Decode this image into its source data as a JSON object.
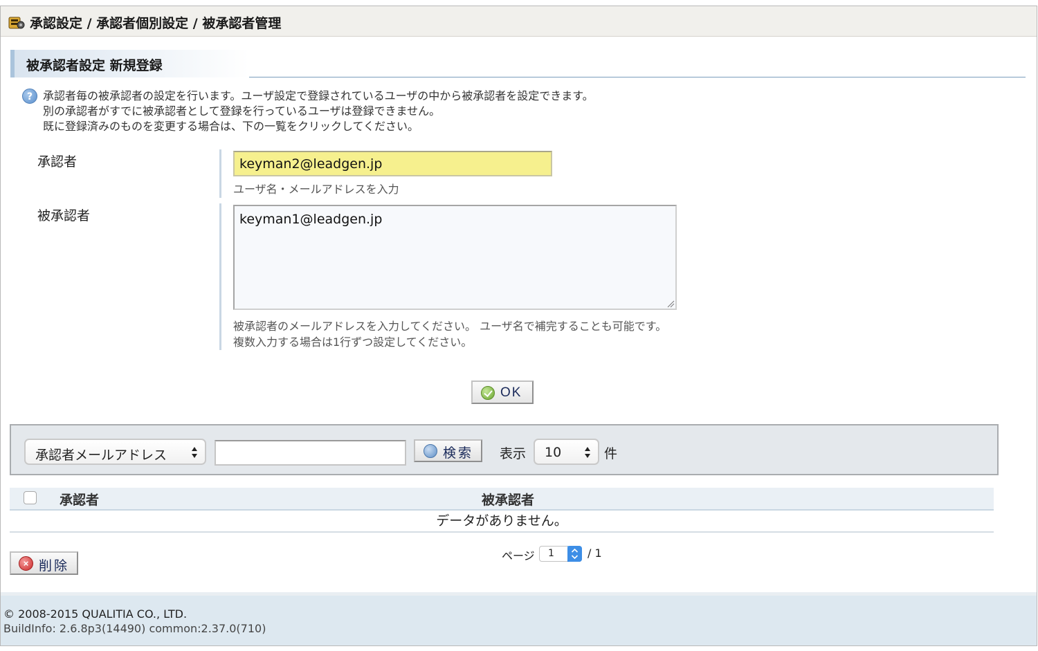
{
  "header": {
    "breadcrumb": "承認設定 / 承認者個別設定 / 被承認者管理"
  },
  "section": {
    "title": "被承認者設定 新規登録"
  },
  "help": {
    "icon": "help-icon",
    "lines": [
      "承認者毎の被承認者の設定を行います。ユーザ設定で登録されているユーザの中から被承認者を設定できます。",
      "別の承認者がすでに被承認者として登録を行っているユーザは登録できません。",
      "既に登録済みのものを変更する場合は、下の一覧をクリックしてください。"
    ]
  },
  "form": {
    "approver_label": "承認者",
    "approver_value": "keyman2@leadgen.jp",
    "approver_hint": "ユーザ名・メールアドレスを入力",
    "approvee_label": "被承認者",
    "approvee_value": "keyman1@leadgen.jp",
    "approvee_hint_1": "被承認者のメールアドレスを入力してください。 ユーザ名で補完することも可能です。",
    "approvee_hint_2": "複数入力する場合は1行ずつ設定してください。",
    "ok_label": "OK"
  },
  "search": {
    "field_select": "承認者メールアドレス",
    "query": "",
    "button_label": "検索",
    "display_label": "表示",
    "per_page": "10",
    "count_unit": "件"
  },
  "table": {
    "columns": [
      "承認者",
      "被承認者"
    ],
    "empty_message": "データがありません。"
  },
  "actions": {
    "delete_label": "削除"
  },
  "pager": {
    "label": "ページ",
    "current": "1",
    "total": "/ 1"
  },
  "footer": {
    "copyright": "© 2008-2015 QUALITIA CO., LTD.",
    "buildinfo": "BuildInfo: 2.6.8p3(14490) common:2.37.0(710)"
  },
  "colors": {
    "approver_input_bg": "#f6f08e",
    "search_panel_bg": "#e4e8ec",
    "footer_bg": "#dde8f0",
    "section_accent": "#aac4dc"
  }
}
